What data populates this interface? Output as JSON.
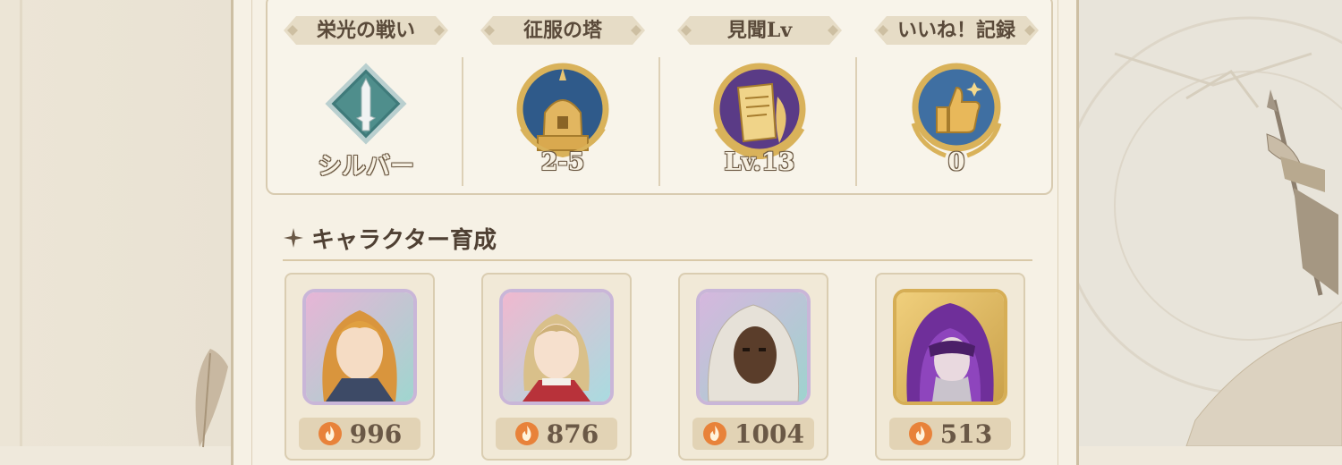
{
  "stats": [
    {
      "label": "栄光の戦い",
      "value": "シルバー",
      "emblem": "silver-rank-icon"
    },
    {
      "label": "征服の塔",
      "value": "2-5",
      "emblem": "tower-icon"
    },
    {
      "label": "見聞Lv",
      "value": "Lv.13",
      "emblem": "scroll-icon"
    },
    {
      "label": "いいね！記録",
      "value": "0",
      "emblem": "thumbs-up-icon"
    }
  ],
  "section": {
    "title": "キャラクター育成",
    "icon": "sparkle-icon"
  },
  "characters": [
    {
      "power": "996",
      "frame": "rainbow",
      "name": "blonde-knight-portrait"
    },
    {
      "power": "876",
      "frame": "rainbow",
      "name": "noble-lady-portrait"
    },
    {
      "power": "1004",
      "frame": "rainbow",
      "name": "hooded-masked-portrait"
    },
    {
      "power": "513",
      "frame": "gold",
      "name": "purple-hood-portrait"
    }
  ],
  "colors": {
    "accent": "#d6ae55",
    "panel": "#f6f1e5",
    "text": "#5a4a3a",
    "flame": "#e8823a"
  }
}
